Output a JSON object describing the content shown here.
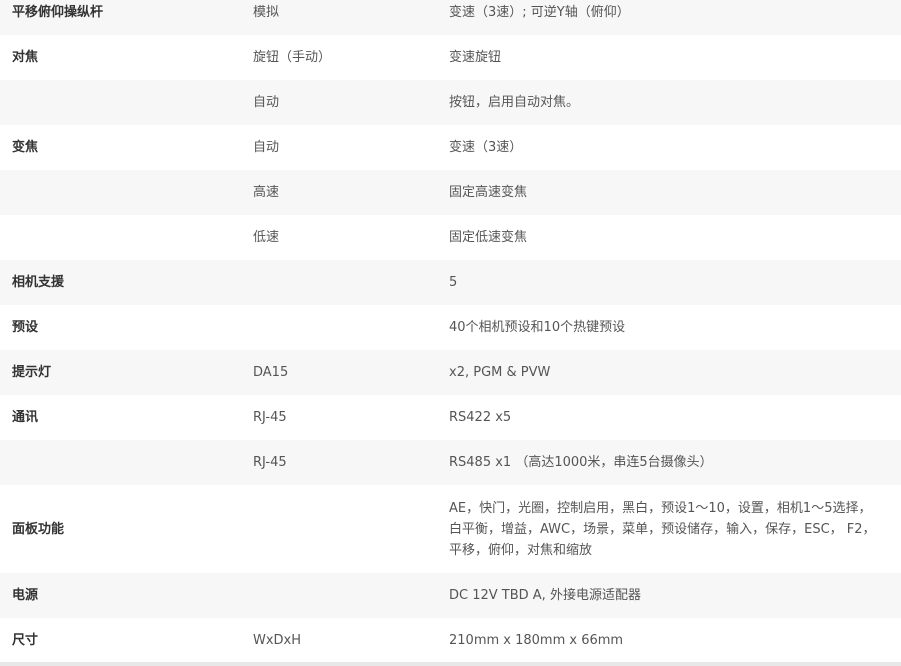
{
  "rows": [
    {
      "feature": "平移俯仰操纵杆",
      "type": "模拟",
      "desc": "变速（3速）; 可逆Y轴（俯仰）"
    },
    {
      "feature": "对焦",
      "type": "旋钮（手动）",
      "desc": "变速旋钮"
    },
    {
      "feature": "",
      "type": "自动",
      "desc": "按钮，启用自动对焦。"
    },
    {
      "feature": "变焦",
      "type": "自动",
      "desc": "变速（3速）"
    },
    {
      "feature": "",
      "type": "高速",
      "desc": "固定高速变焦"
    },
    {
      "feature": "",
      "type": "低速",
      "desc": "固定低速变焦"
    },
    {
      "feature": "相机支援",
      "type": "",
      "desc": "5"
    },
    {
      "feature": "预设",
      "type": "",
      "desc": "40个相机预设和10个热键预设"
    },
    {
      "feature": "提示灯",
      "type": "DA15",
      "desc": "x2, PGM & PVW"
    },
    {
      "feature": "通讯",
      "type": "RJ-45",
      "desc": "RS422 x5"
    },
    {
      "feature": "",
      "type": "RJ-45",
      "desc": "RS485 x1 （高达1000米，串连5台摄像头）"
    },
    {
      "feature": "面板功能",
      "type": "",
      "desc": "AE，快门，光圈，控制启用，黑白，预设1〜10，设置，相机1〜5选择，白平衡，增益，AWC，场景，菜单，预设储存，输入，保存，ESC， F2，平移，俯仰，对焦和缩放"
    },
    {
      "feature": "电源",
      "type": "",
      "desc": "DC 12V TBD A, 外接电源适配器"
    },
    {
      "feature": "尺寸",
      "type": "WxDxH",
      "desc": "210mm x 180mm x 66mm"
    }
  ]
}
